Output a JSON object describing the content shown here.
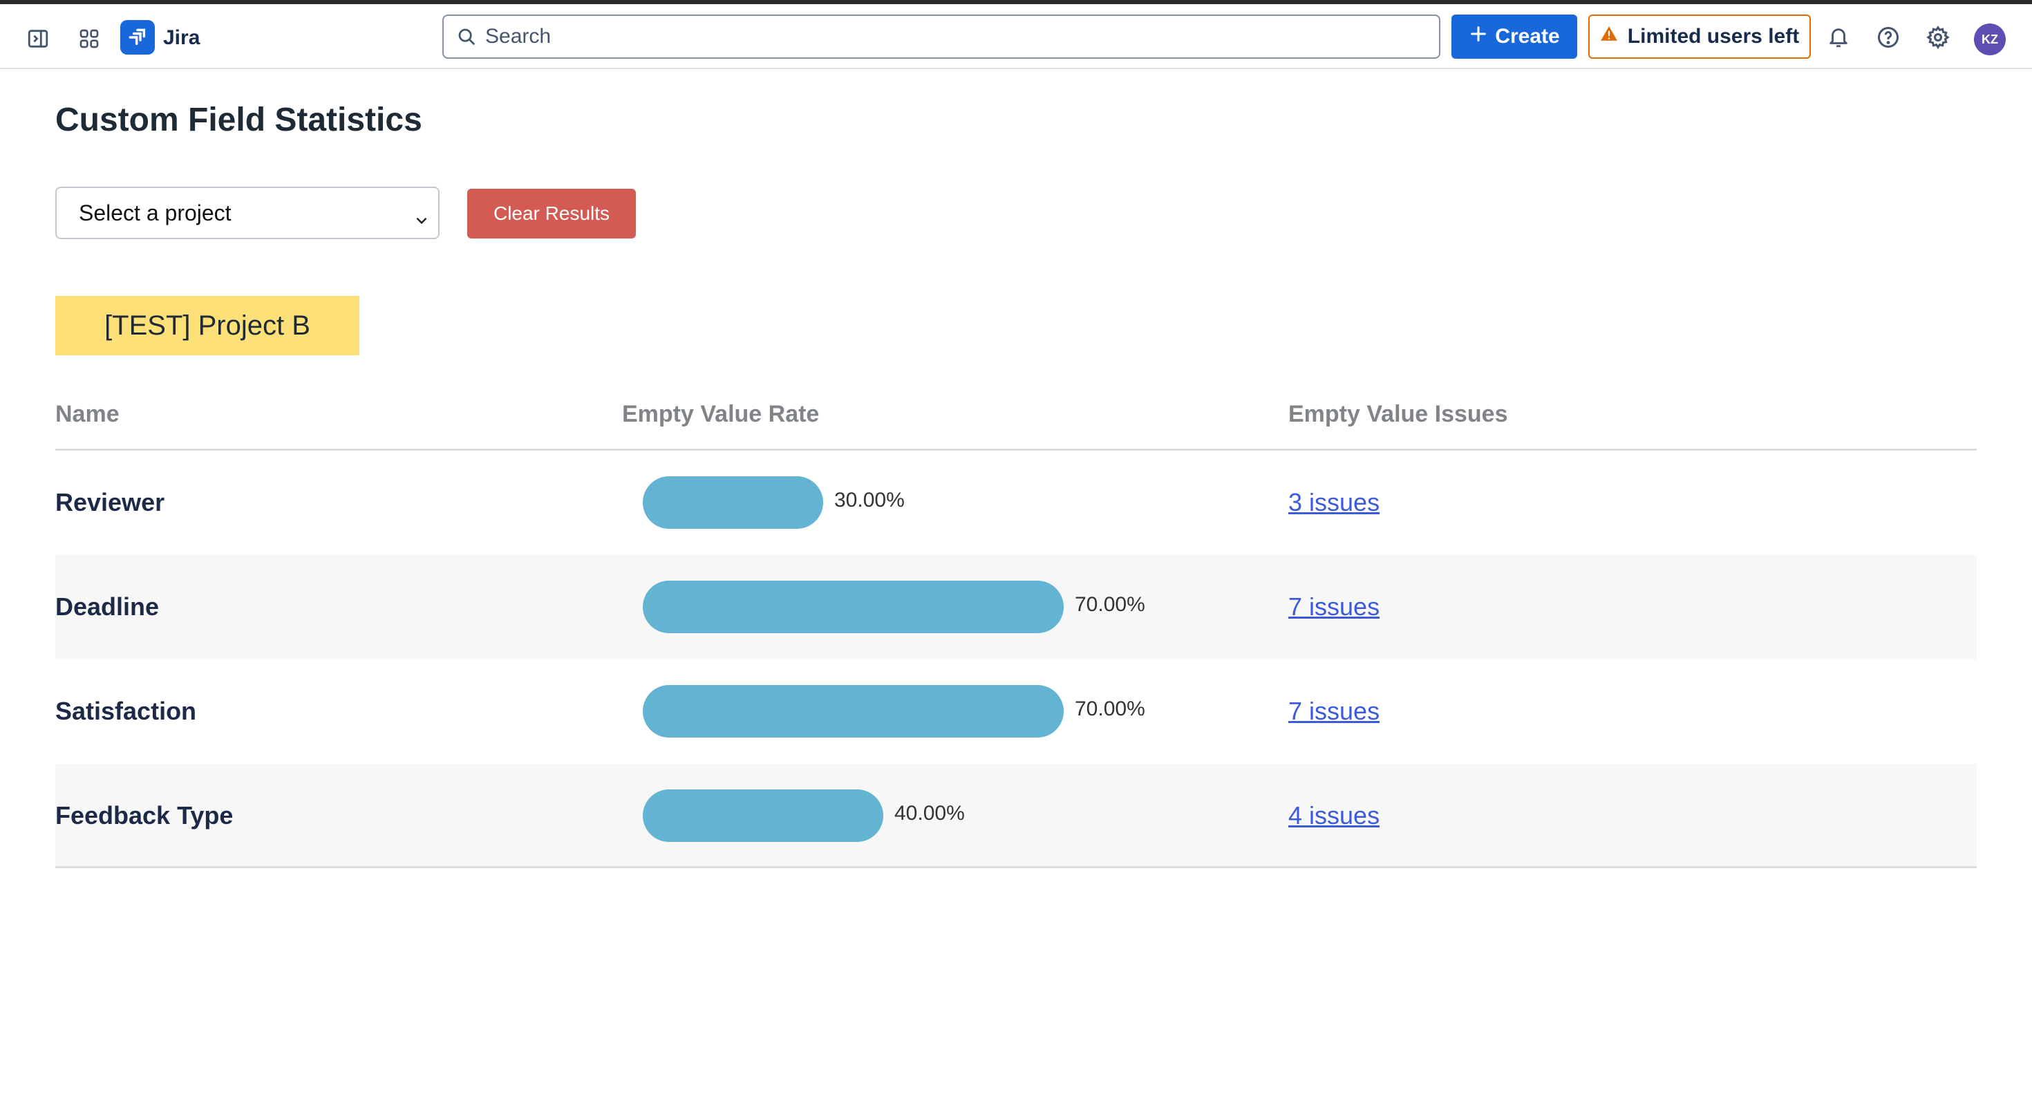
{
  "topnav": {
    "app_name": "Jira",
    "search_placeholder": "Search",
    "create_label": "Create",
    "limited_label": "Limited users left",
    "avatar_initials": "KZ"
  },
  "page": {
    "title": "Custom Field Statistics",
    "select_value": "Select a project",
    "clear_label": "Clear Results",
    "project_name": "[TEST] Project B"
  },
  "table": {
    "headers": {
      "name": "Name",
      "rate": "Empty Value Rate",
      "issues": "Empty Value Issues"
    },
    "rows": [
      {
        "name": "Reviewer",
        "rate": 30,
        "rate_label": "30.00%",
        "issues": "3 issues"
      },
      {
        "name": "Deadline",
        "rate": 70,
        "rate_label": "70.00%",
        "issues": "7 issues"
      },
      {
        "name": "Satisfaction",
        "rate": 70,
        "rate_label": "70.00%",
        "issues": "7 issues"
      },
      {
        "name": "Feedback Type",
        "rate": 40,
        "rate_label": "40.00%",
        "issues": "4 issues"
      }
    ]
  },
  "colors": {
    "accent": "#1868db",
    "bar": "#63b3d2",
    "clear": "#d45b54",
    "badge": "#fde078",
    "warning": "#e06c00",
    "link": "#3b5bdb"
  }
}
